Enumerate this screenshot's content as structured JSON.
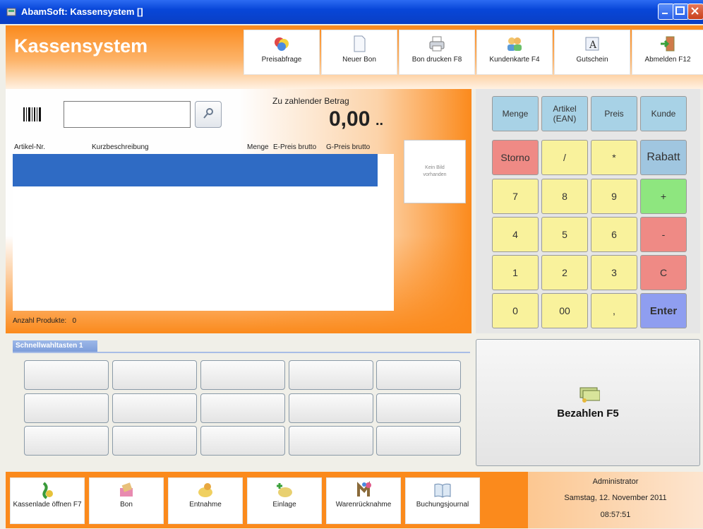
{
  "window": {
    "title": "AbamSoft: Kassensystem  []"
  },
  "header": {
    "app_title": "Kassensystem",
    "buttons": [
      {
        "label": "Preisabfrage",
        "icon": "price-query-icon"
      },
      {
        "label": "Neuer Bon",
        "icon": "new-document-icon"
      },
      {
        "label": "Bon drucken  F8",
        "icon": "printer-icon"
      },
      {
        "label": "Kundenkarte  F4",
        "icon": "customers-icon"
      },
      {
        "label": "Gutschein",
        "icon": "voucher-icon"
      },
      {
        "label": "Abmelden  F12",
        "icon": "logout-icon"
      }
    ]
  },
  "entry": {
    "amount_label": "Zu zahlender Betrag",
    "amount": "0,00",
    "amount_suffix": ".."
  },
  "table": {
    "columns": [
      "Artikel-Nr.",
      "Kurzbeschreibung",
      "Menge",
      "E-Preis brutto",
      "G-Preis brutto"
    ],
    "count_label": "Anzahl Produkte:",
    "count_value": "0"
  },
  "image_placeholder": {
    "line1": "Kein Bild",
    "line2": "vorhanden"
  },
  "keypad": {
    "keys": [
      {
        "label": "Menge",
        "style": "blue"
      },
      {
        "label": "Artikel (EAN)",
        "style": "blue"
      },
      {
        "label": "Preis",
        "style": "blue"
      },
      {
        "label": "Kunde",
        "style": "blue"
      },
      {
        "label": "Storno",
        "style": "red"
      },
      {
        "label": "/",
        "style": "yel"
      },
      {
        "label": "*",
        "style": "yel"
      },
      {
        "label": "Rabatt",
        "style": "teal"
      },
      {
        "label": "7",
        "style": "yel"
      },
      {
        "label": "8",
        "style": "yel"
      },
      {
        "label": "9",
        "style": "yel"
      },
      {
        "label": "+",
        "style": "grn"
      },
      {
        "label": "4",
        "style": "yel"
      },
      {
        "label": "5",
        "style": "yel"
      },
      {
        "label": "6",
        "style": "yel"
      },
      {
        "label": "-",
        "style": "red"
      },
      {
        "label": "1",
        "style": "yel"
      },
      {
        "label": "2",
        "style": "yel"
      },
      {
        "label": "3",
        "style": "yel"
      },
      {
        "label": "C",
        "style": "red"
      },
      {
        "label": "0",
        "style": "yel"
      },
      {
        "label": "00",
        "style": "yel"
      },
      {
        "label": ",",
        "style": "yel"
      },
      {
        "label": "Enter",
        "style": "pur"
      }
    ]
  },
  "quick_keys": {
    "tab_label": "Schnellwahltasten 1"
  },
  "pay": {
    "label": "Bezahlen  F5"
  },
  "footer": {
    "buttons": [
      {
        "label": "Kassenlade öffnen F7",
        "icon": "cash-drawer-icon"
      },
      {
        "label": "Bon",
        "icon": "receipt-icon"
      },
      {
        "label": "Entnahme",
        "icon": "withdrawal-icon"
      },
      {
        "label": "Einlage",
        "icon": "deposit-icon"
      },
      {
        "label": "Warenrücknahme",
        "icon": "return-icon"
      },
      {
        "label": "Buchungsjournal",
        "icon": "journal-icon"
      }
    ],
    "user": "Administrator",
    "date": "Samstag, 12. November 2011",
    "time": "08:57:51"
  },
  "colors": {
    "accent": "#fb8a1c",
    "selection": "#2f6bc4",
    "titlebar": "#0846d8"
  }
}
